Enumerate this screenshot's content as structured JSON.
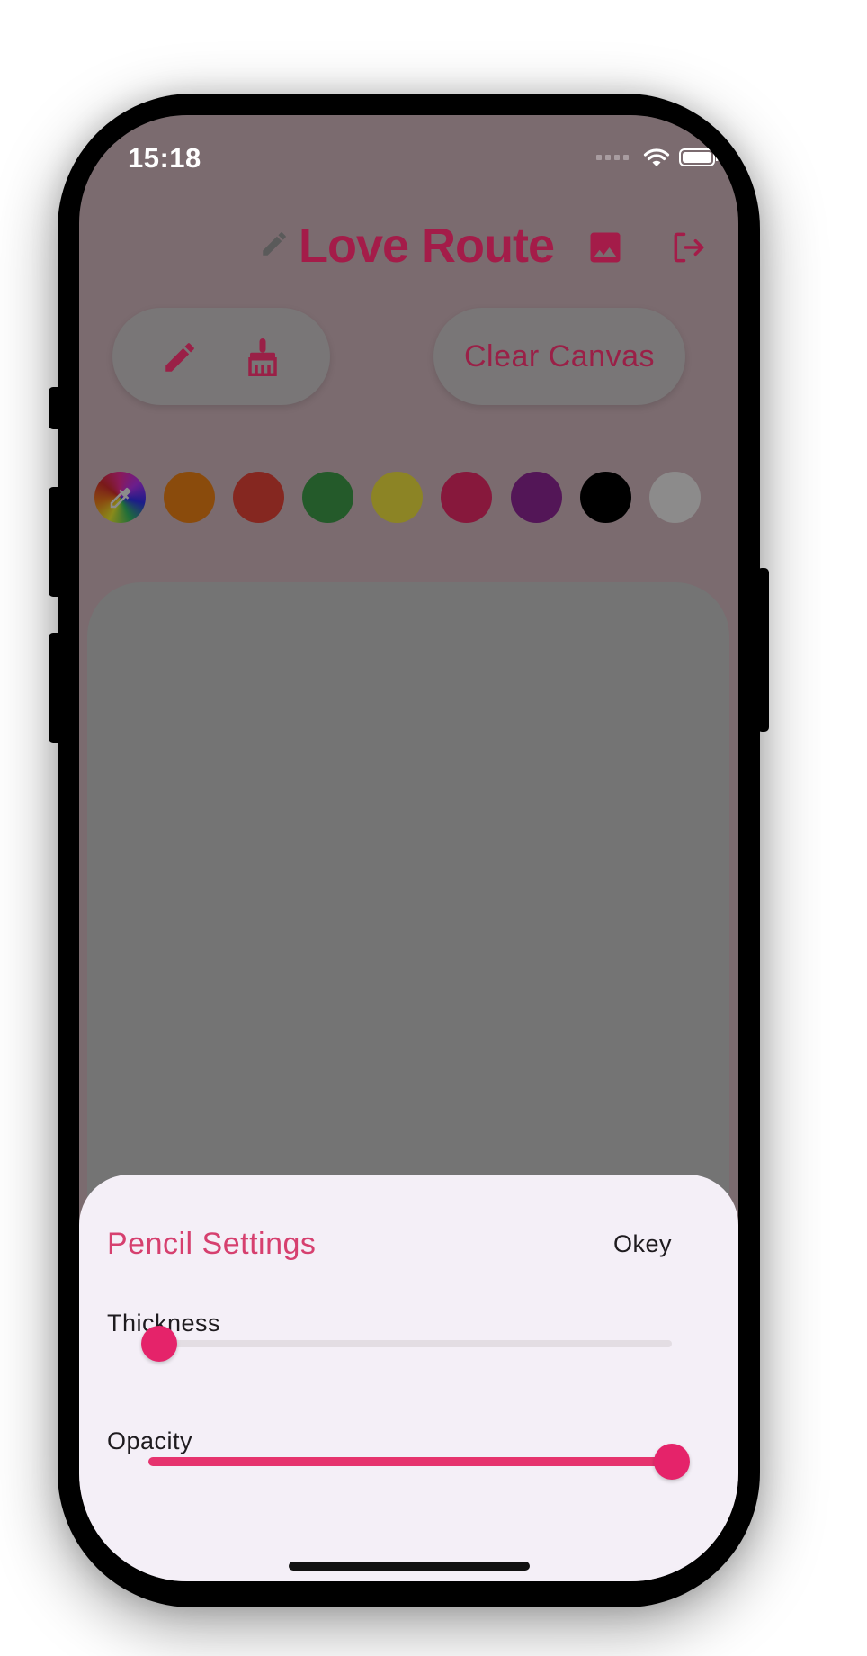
{
  "status_bar": {
    "time": "15:18"
  },
  "header": {
    "title": "Love Route",
    "title_icon": "pencil-icon",
    "actions": [
      "image-icon",
      "logout-icon"
    ]
  },
  "toolbar": {
    "tools": [
      "pencil-icon",
      "broom-icon"
    ],
    "clear_label": "Clear Canvas"
  },
  "palette": {
    "picker_icon": "eyedropper-icon",
    "colors": [
      "#8a4b0c",
      "#852720",
      "#245a2a",
      "#8c8425",
      "#87183c",
      "#531657",
      "#000000",
      "#8c8b8b"
    ]
  },
  "pencil_settings": {
    "title": "Pencil Settings",
    "confirm_label": "Okey",
    "thickness": {
      "label": "Thickness",
      "value": 0.02
    },
    "opacity": {
      "label": "Opacity",
      "value": 1.0
    }
  },
  "theme": {
    "accent": "#e6336e",
    "title_color": "#a41c49",
    "sheet_bg": "#f4eff7"
  }
}
